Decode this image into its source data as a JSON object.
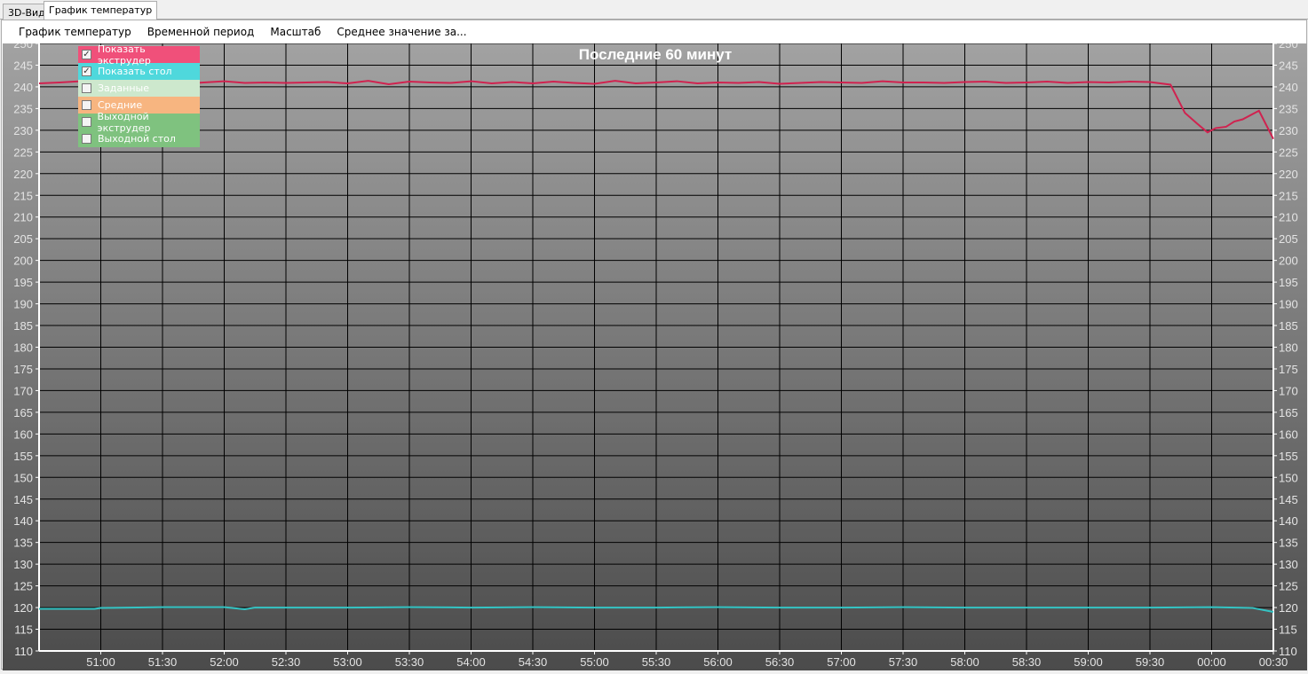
{
  "tabs": [
    "3D-Вид",
    "График температур"
  ],
  "menu": [
    "График температур",
    "Временной период",
    "Масштаб",
    "Среднее значение за..."
  ],
  "legend": [
    {
      "label": "Показать экструдер",
      "checked": true,
      "color": "#f0507a"
    },
    {
      "label": "Показать стол",
      "checked": true,
      "color": "#4fd8dc"
    },
    {
      "label": "Заданные",
      "checked": false,
      "color": "#cde8cd"
    },
    {
      "label": "Средние",
      "checked": false,
      "color": "#f7b580"
    },
    {
      "label": "Выходной экструдер",
      "checked": false,
      "color": "#7fc27f"
    },
    {
      "label": "Выходной стол",
      "checked": false,
      "color": "#7fc27f"
    }
  ],
  "chart_data": {
    "type": "line",
    "title": "Последние 60 минут",
    "ylim": [
      110,
      250
    ],
    "yticks": [
      110,
      115,
      120,
      125,
      130,
      135,
      140,
      145,
      150,
      155,
      160,
      165,
      170,
      175,
      180,
      185,
      190,
      195,
      200,
      205,
      210,
      215,
      220,
      225,
      230,
      235,
      240,
      245,
      250
    ],
    "x_unit": "seconds since 50:30",
    "xlim": [
      0,
      600
    ],
    "xticks": [
      30,
      60,
      90,
      120,
      150,
      180,
      210,
      240,
      270,
      300,
      330,
      360,
      390,
      420,
      450,
      480,
      510,
      540,
      570,
      600
    ],
    "xtick_labels": [
      "51:00",
      "51:30",
      "52:00",
      "52:30",
      "53:00",
      "53:30",
      "54:00",
      "54:30",
      "55:00",
      "55:30",
      "56:00",
      "56:30",
      "57:00",
      "57:30",
      "58:00",
      "58:30",
      "59:00",
      "59:30",
      "00:00",
      "00:30"
    ],
    "series": [
      {
        "name": "Экструдер",
        "color": "#d0224f",
        "x": [
          0,
          10,
          20,
          30,
          40,
          50,
          60,
          70,
          80,
          90,
          100,
          110,
          120,
          130,
          140,
          150,
          160,
          170,
          180,
          190,
          200,
          210,
          220,
          230,
          240,
          250,
          260,
          270,
          280,
          290,
          300,
          310,
          320,
          330,
          340,
          350,
          360,
          370,
          380,
          390,
          400,
          410,
          420,
          430,
          440,
          450,
          460,
          470,
          480,
          490,
          500,
          510,
          520,
          530,
          540,
          550,
          557,
          563,
          568,
          572,
          577,
          581,
          585,
          593,
          600
        ],
        "y": [
          240.8,
          241,
          241.3,
          240.9,
          241,
          241.2,
          241.1,
          240.7,
          241,
          241.3,
          240.9,
          241,
          240.9,
          241,
          241.1,
          240.8,
          241.4,
          240.6,
          241.2,
          241,
          240.9,
          241.3,
          240.8,
          241.1,
          240.8,
          241.2,
          240.9,
          240.7,
          241.4,
          240.8,
          241,
          241.3,
          240.8,
          241,
          240.9,
          241.1,
          240.7,
          240.9,
          241.1,
          241,
          240.9,
          241.3,
          241,
          241,
          240.9,
          241.1,
          241.2,
          240.9,
          241,
          241.2,
          240.9,
          241.1,
          241,
          241.2,
          241.1,
          240.5,
          234,
          231.5,
          229.5,
          230.5,
          230.8,
          232,
          232.5,
          234.5,
          228
        ]
      },
      {
        "name": "Стол",
        "color": "#34c4c4",
        "x": [
          0,
          10,
          20,
          27,
          30,
          60,
          90,
          100,
          105,
          110,
          150,
          180,
          210,
          240,
          270,
          300,
          330,
          360,
          390,
          420,
          450,
          480,
          510,
          540,
          570,
          590,
          600
        ],
        "y": [
          119.7,
          119.7,
          119.7,
          119.7,
          119.9,
          120.1,
          120.1,
          119.6,
          120,
          120,
          120,
          120.1,
          120,
          120.1,
          120,
          120,
          120.1,
          120,
          120,
          120.1,
          120,
          120,
          120,
          120,
          120.1,
          119.9,
          119
        ]
      }
    ]
  }
}
